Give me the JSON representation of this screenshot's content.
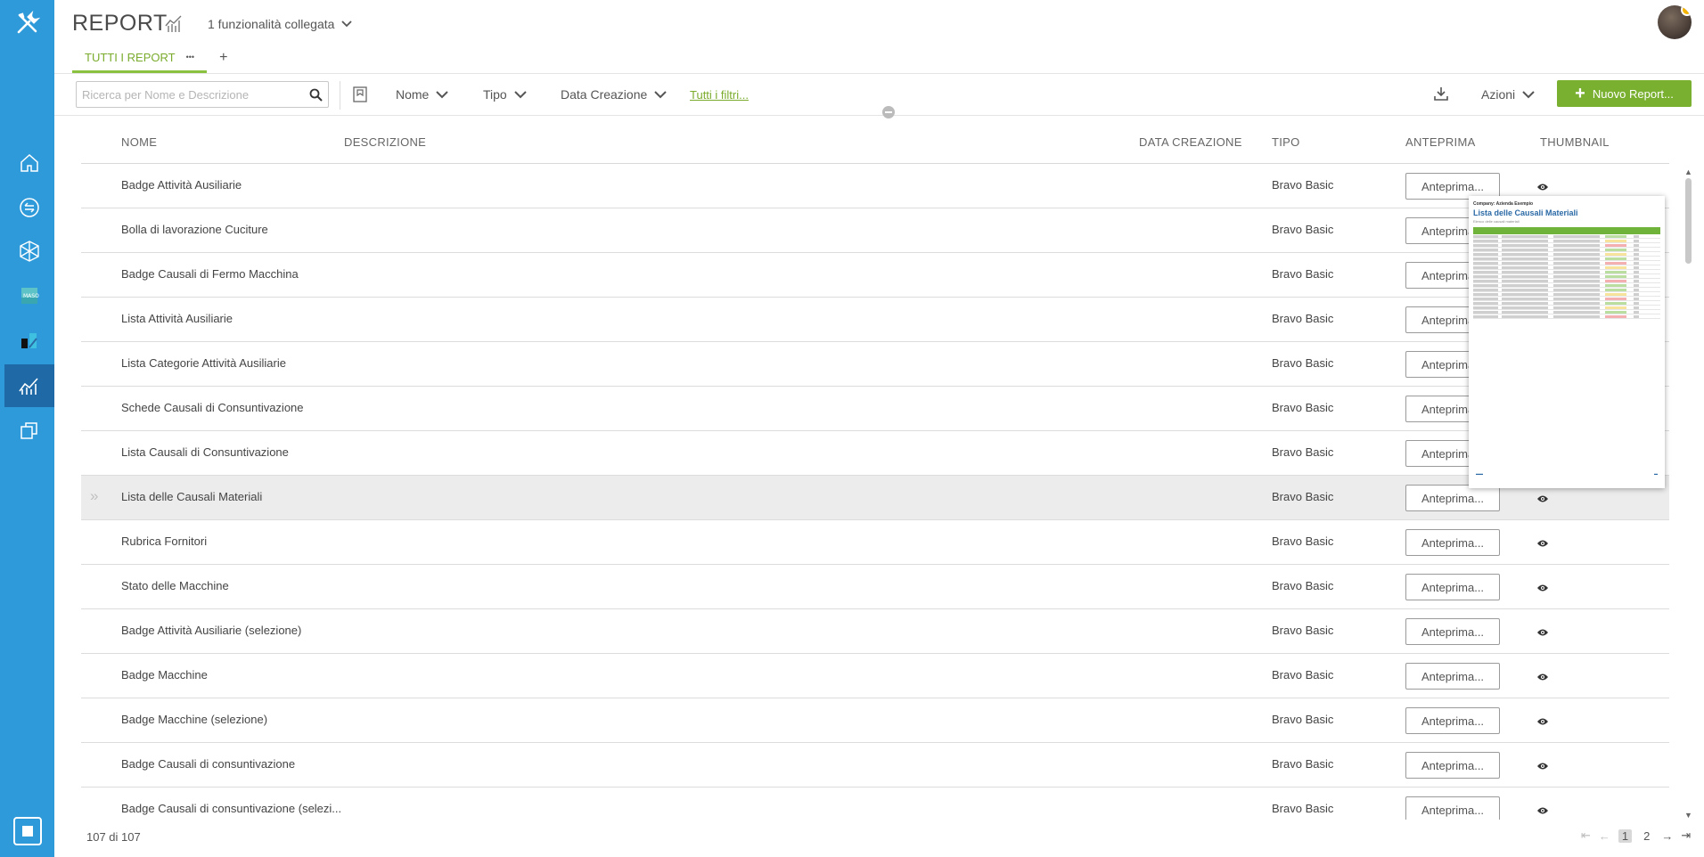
{
  "app": {
    "title": "REPORT",
    "linked": "1 funzionalità collegata"
  },
  "tabs": {
    "active": "TUTTI I REPORT",
    "more": "•••",
    "add": "+"
  },
  "toolbar": {
    "search_placeholder": "Ricerca per Nome e Descrizione",
    "filter_nome": "Nome",
    "filter_tipo": "Tipo",
    "filter_data": "Data Creazione",
    "all_filters": "Tutti i filtri...",
    "azioni": "Azioni",
    "new_report": "Nuovo Report..."
  },
  "table": {
    "headers": {
      "nome": "NOME",
      "descrizione": "DESCRIZIONE",
      "data": "DATA CREAZIONE",
      "tipo": "TIPO",
      "anteprima": "ANTEPRIMA",
      "thumbnail": "THUMBNAIL"
    },
    "preview_label": "Anteprima...",
    "rows": [
      {
        "nome": "Badge Attività Ausiliarie",
        "tipo": "Bravo Basic"
      },
      {
        "nome": "Bolla di lavorazione Cuciture",
        "tipo": "Bravo Basic"
      },
      {
        "nome": "Badge Causali di Fermo Macchina",
        "tipo": "Bravo Basic"
      },
      {
        "nome": "Lista Attività Ausiliarie",
        "tipo": "Bravo Basic"
      },
      {
        "nome": "Lista Categorie Attività Ausiliarie",
        "tipo": "Bravo Basic"
      },
      {
        "nome": "Schede Causali di Consuntivazione",
        "tipo": "Bravo Basic"
      },
      {
        "nome": "Lista Causali di Consuntivazione",
        "tipo": "Bravo Basic"
      },
      {
        "nome": "Lista delle Causali Materiali",
        "tipo": "Bravo Basic"
      },
      {
        "nome": "Rubrica Fornitori",
        "tipo": "Bravo Basic"
      },
      {
        "nome": "Stato delle Macchine",
        "tipo": "Bravo Basic"
      },
      {
        "nome": "Badge Attività Ausiliarie (selezione)",
        "tipo": "Bravo Basic"
      },
      {
        "nome": "Badge Macchine",
        "tipo": "Bravo Basic"
      },
      {
        "nome": "Badge Macchine (selezione)",
        "tipo": "Bravo Basic"
      },
      {
        "nome": "Badge Causali di consuntivazione",
        "tipo": "Bravo Basic"
      },
      {
        "nome": "Badge Causali di consuntivazione (selezi...",
        "tipo": "Bravo Basic"
      }
    ]
  },
  "thumbnail": {
    "company": "Company: Azienda Esempio",
    "title": "Lista delle Causali Materiali",
    "subtitle": "Elenco delle causali materiali"
  },
  "footer": {
    "count": "107 di 107",
    "page_current": "1",
    "page_next": "2"
  },
  "colors": {
    "rail": "#2f9ad9",
    "rail_active": "#1f6aa6",
    "accent": "#7ab030"
  },
  "icons": [
    "tools-icon",
    "home-icon",
    "exchange-icon",
    "cube-network-icon",
    "maso-icon",
    "chart-icon",
    "report-chart-icon",
    "copy-icon",
    "search-icon",
    "bookmark-icon",
    "download-icon",
    "eye-icon"
  ]
}
